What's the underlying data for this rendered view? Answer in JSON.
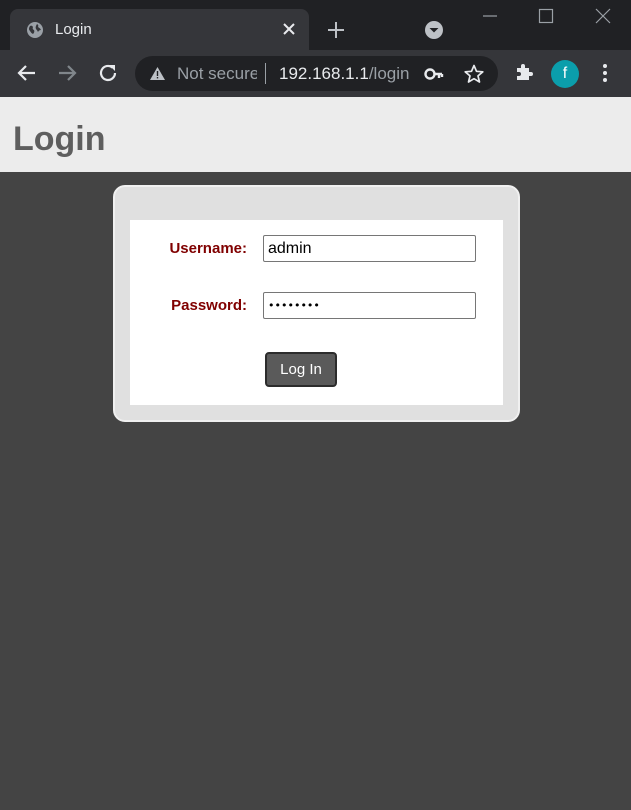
{
  "browser": {
    "tab": {
      "title": "Login",
      "favicon": "globe-icon"
    },
    "address_bar": {
      "security_label": "Not secure",
      "url_host": "192.168.1.1",
      "url_path": "/login"
    },
    "profile_initial": "f",
    "colors": {
      "avatar": "#0b9eab",
      "frame": "#202124",
      "toolbar": "#35363a"
    }
  },
  "page": {
    "title": "Login",
    "form": {
      "username_label": "Username:",
      "username_value": "admin",
      "password_label": "Password:",
      "password_value": "••••••••",
      "submit_label": "Log In"
    },
    "colors": {
      "label": "#800000",
      "background": "#444444",
      "header": "#ececec"
    }
  }
}
